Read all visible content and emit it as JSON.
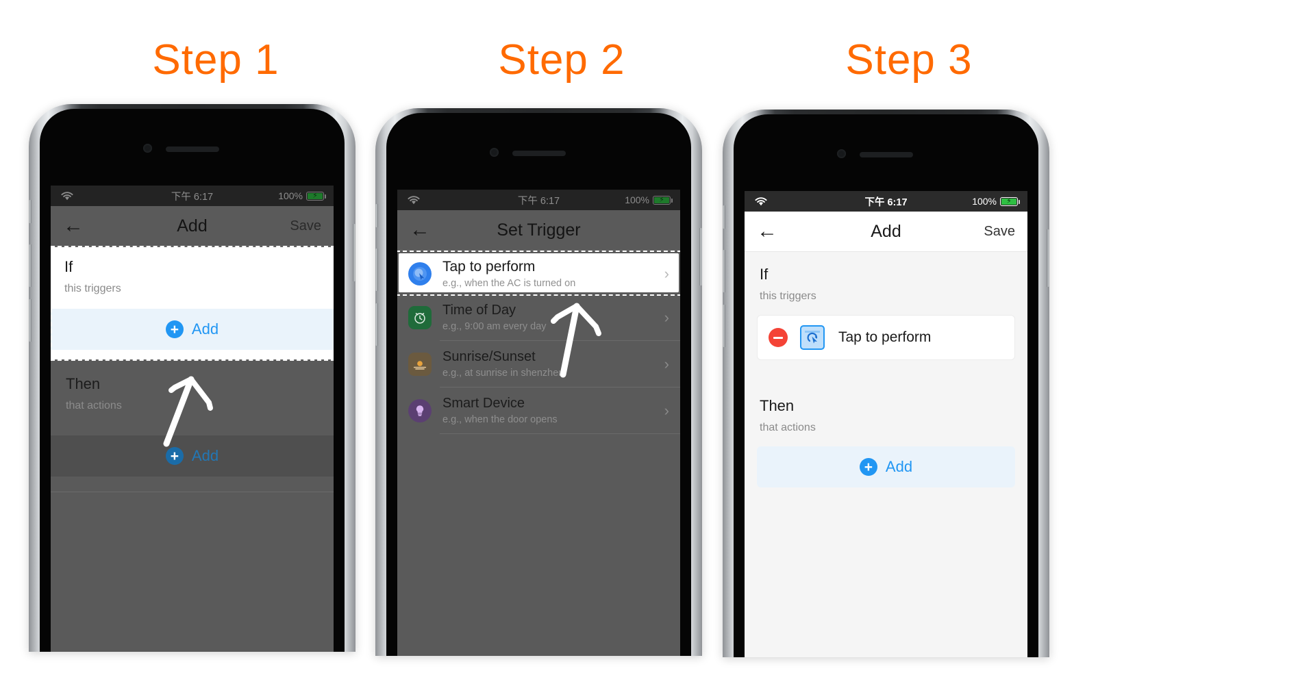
{
  "steps": [
    {
      "label": "Step 1"
    },
    {
      "label": "Step 2"
    },
    {
      "label": "Step 3"
    }
  ],
  "colors": {
    "step_orange": "#FF6A00",
    "accent_blue": "#2196F3",
    "delete_red": "#F44336",
    "battery_green": "#2FBF43",
    "dim_overlay": "#5A5A5A"
  },
  "status_bar": {
    "wifi_icon": "wifi-icon",
    "time": "下午 6:17",
    "battery_percent": "100%",
    "battery_icon": "battery-charging-icon"
  },
  "phone1": {
    "appbar": {
      "back_icon": "back-arrow-icon",
      "title": "Add",
      "action_label": "Save"
    },
    "if_section": {
      "title": "If",
      "subtitle": "this triggers",
      "add_button": {
        "label": "Add",
        "icon": "plus-circle-icon"
      }
    },
    "then_section": {
      "title": "Then",
      "subtitle": "that actions",
      "add_button": {
        "label": "Add",
        "icon": "plus-circle-icon"
      }
    },
    "annotation": {
      "type": "hand-drawn-arrow",
      "points_to": "if-add-button"
    }
  },
  "phone2": {
    "appbar": {
      "back_icon": "back-arrow-icon",
      "title": "Set Trigger"
    },
    "trigger_list": [
      {
        "title": "Tap to perform",
        "subtitle": "e.g., when the AC is turned on",
        "icon": "tap-cursor-icon",
        "icon_color": "#2F7FEC",
        "highlighted": true
      },
      {
        "title": "Time of Day",
        "subtitle": "e.g., 9:00 am every day",
        "icon": "alarm-clock-icon",
        "icon_color": "#1F6B3A",
        "highlighted": false
      },
      {
        "title": "Sunrise/Sunset",
        "subtitle": "e.g., at sunrise in shenzhen",
        "icon": "sunrise-icon",
        "icon_color": "#C98A3A",
        "highlighted": false
      },
      {
        "title": "Smart Device",
        "subtitle": "e.g., when the door opens",
        "icon": "lightbulb-icon",
        "icon_color": "#7A4FA8",
        "highlighted": false
      }
    ],
    "annotation": {
      "type": "hand-drawn-arrow",
      "points_to": "tap-to-perform-row"
    }
  },
  "phone3": {
    "appbar": {
      "back_icon": "back-arrow-icon",
      "title": "Add",
      "action_label": "Save"
    },
    "if_section": {
      "title": "If",
      "subtitle": "this triggers",
      "trigger_card": {
        "delete_icon": "remove-circle-icon",
        "tile_icon": "tap-cursor-tile-icon",
        "label": "Tap to perform"
      }
    },
    "then_section": {
      "title": "Then",
      "subtitle": "that actions",
      "add_button": {
        "label": "Add",
        "icon": "plus-circle-icon"
      }
    }
  }
}
